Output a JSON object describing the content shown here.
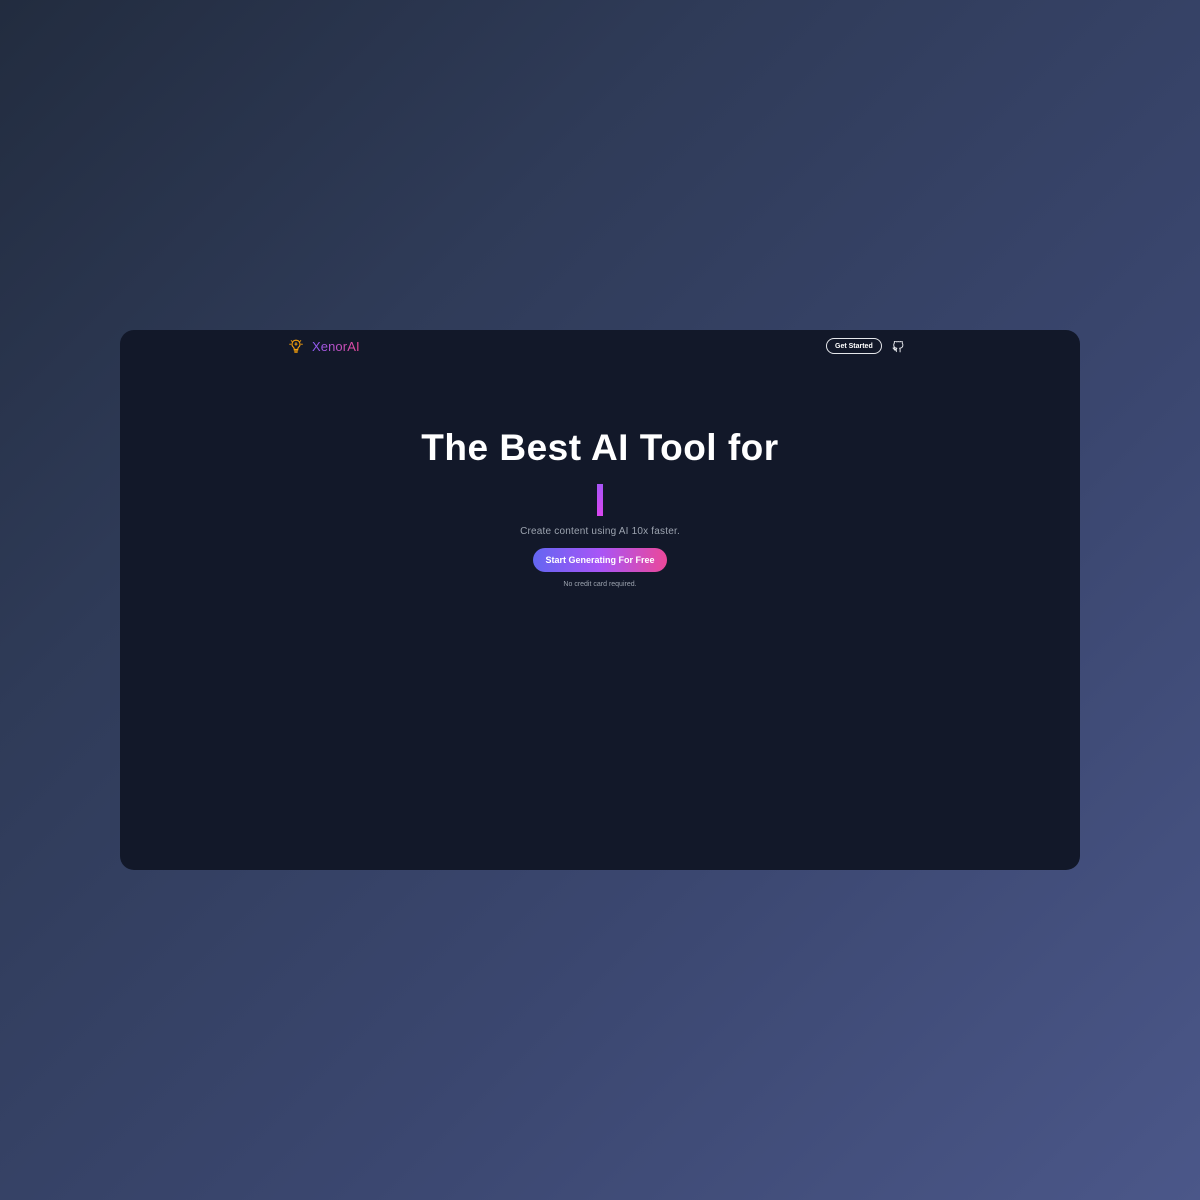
{
  "nav": {
    "brand_name": "XenorAI",
    "brand_icon": "lightbulb-icon",
    "get_started_label": "Get Started",
    "github_icon": "github-icon"
  },
  "hero": {
    "title": "The Best AI Tool for",
    "typed_text": "",
    "subtitle": "Create content using AI 10x faster.",
    "cta_label": "Start Generating For Free",
    "note": "No credit card required."
  },
  "colors": {
    "page_background_start": "#222c3f",
    "page_background_end": "#4b5789",
    "window_background": "#121829",
    "brand_gradient_start": "#8b5cf6",
    "brand_gradient_end": "#ec4899",
    "logo_color": "#f59e0b",
    "cta_gradient_start": "#6366f1",
    "cta_gradient_end": "#ec4899",
    "muted_text": "#9ca3af"
  }
}
